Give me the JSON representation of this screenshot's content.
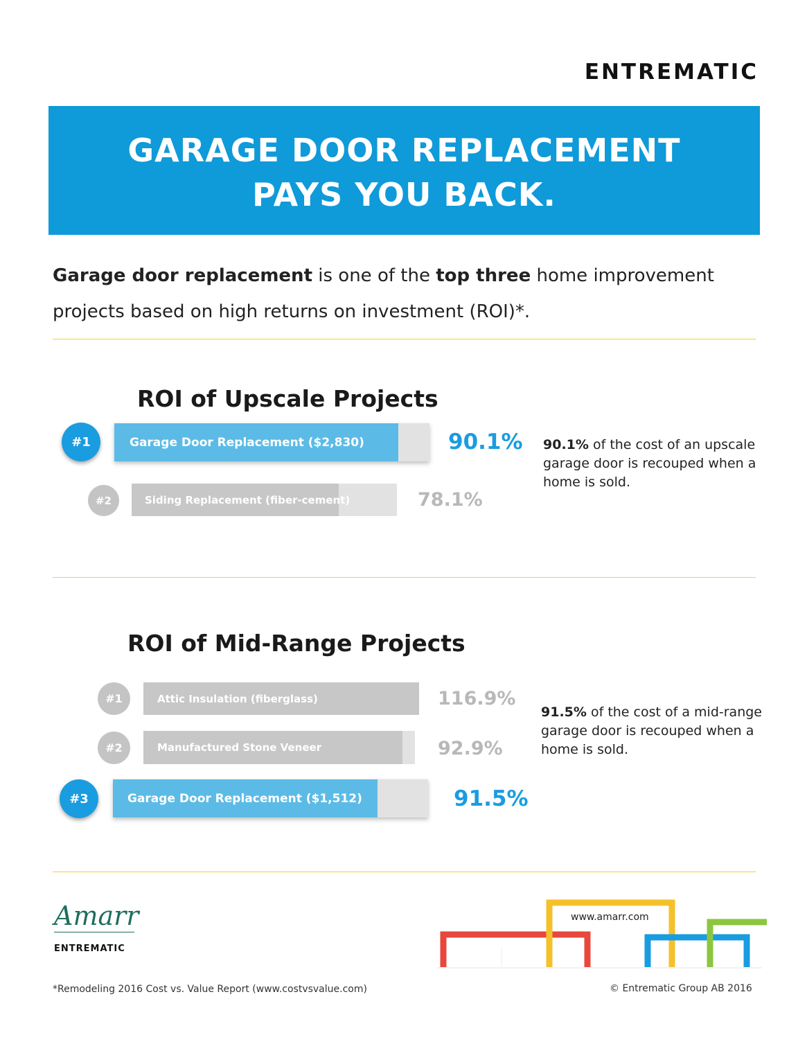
{
  "brand": {
    "logo_text": "ENTREMATIC",
    "colors": {
      "blue": "#0f9ad9",
      "accent_blue": "#1a9ce0",
      "bar_blue": "#5cbbe6",
      "gray": "#c7c7c7",
      "rule_yellow": "#f2d233"
    }
  },
  "banner": {
    "line1": "GARAGE DOOR REPLACEMENT",
    "line2": "PAYS YOU BACK."
  },
  "intro": {
    "bold1": "Garage door replacement",
    "text1": " is one of the ",
    "bold2": "top three",
    "text2": " home improvement",
    "line2": "projects based on high returns on investment (ROI)*."
  },
  "upscale": {
    "title": "ROI of Upscale Projects",
    "items": [
      {
        "rank": "#1",
        "label": "Garage Door Replacement ($2,830)",
        "value_text": "90.1%"
      },
      {
        "rank": "#2",
        "label": "Siding Replacement (fiber-cement)",
        "value_text": "78.1%"
      }
    ],
    "note_bold": "90.1%",
    "note_line1": " of the cost of an upscale",
    "note_line2": "garage door is recouped when a",
    "note_line3": "home is sold."
  },
  "midrange": {
    "title": "ROI of Mid-Range Projects",
    "items": [
      {
        "rank": "#1",
        "label": "Attic Insulation (fiberglass)",
        "value_text": "116.9%"
      },
      {
        "rank": "#2",
        "label": "Manufactured Stone Veneer",
        "value_text": "92.9%"
      },
      {
        "rank": "#3",
        "label": "Garage Door Replacement ($1,512)",
        "value_text": "91.5%"
      }
    ],
    "note_bold": "91.5%",
    "note_line1": " of the cost of a mid-range",
    "note_line2": "garage door is recouped when a",
    "note_line3": "home is sold."
  },
  "footer": {
    "amarr": "Amarr",
    "amarr_sub": "ENTREMATIC",
    "website": "www.amarr.com",
    "source": "*Remodeling 2016 Cost vs. Value Report (www.costvsvalue.com)",
    "copyright": "© Entrematic Group AB 2016"
  },
  "chart_data": [
    {
      "type": "bar",
      "title": "ROI of Upscale Projects",
      "categories": [
        "Garage Door Replacement ($2,830)",
        "Siding Replacement (fiber-cement)"
      ],
      "values": [
        90.1,
        78.1
      ],
      "unit": "%"
    },
    {
      "type": "bar",
      "title": "ROI of Mid-Range Projects",
      "categories": [
        "Attic Insulation (fiberglass)",
        "Manufactured Stone Veneer",
        "Garage Door Replacement ($1,512)"
      ],
      "values": [
        116.9,
        92.9,
        91.5
      ],
      "unit": "%"
    }
  ]
}
